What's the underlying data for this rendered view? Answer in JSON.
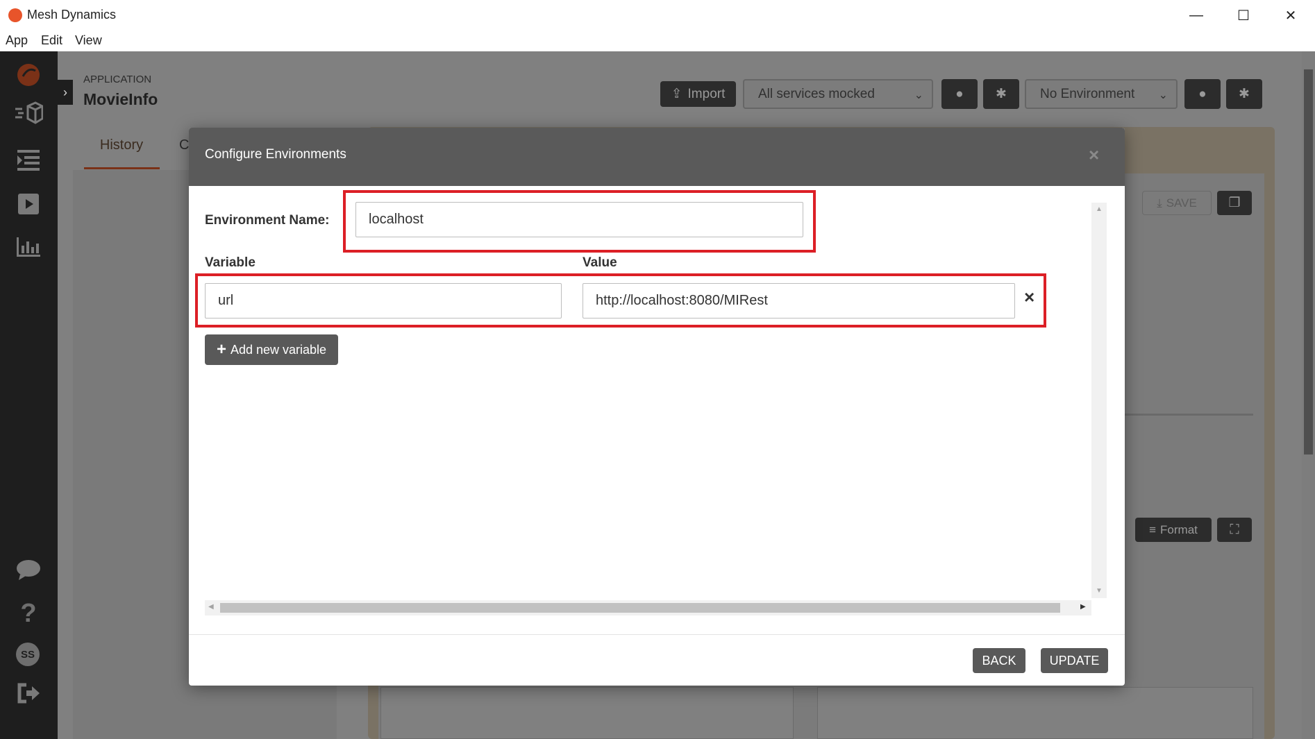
{
  "window": {
    "title": "Mesh Dynamics",
    "minimize_glyph": "—",
    "maximize_glyph": "☐",
    "close_glyph": "✕"
  },
  "menu": [
    "App",
    "Edit",
    "View"
  ],
  "sidebar": {
    "icons": [
      "logo-icon",
      "cube-icon",
      "list-icon",
      "play-icon",
      "bar-chart-icon",
      "chat-icon",
      "help-icon",
      "avatar",
      "logout-icon"
    ],
    "avatar_initials": "SS"
  },
  "panel": {
    "section_label": "APPLICATION",
    "app_name": "MovieInfo",
    "tabs": [
      "History",
      "C"
    ],
    "accent_color": "#e8542a"
  },
  "toolbar": {
    "import_label": "Import",
    "services_select": "All services mocked",
    "environment_select": "No Environment"
  },
  "editor": {
    "save_label": "SAVE",
    "format_label": "Format"
  },
  "modal": {
    "title": "Configure Environments",
    "env_name_label": "Environment Name:",
    "env_name_value": "localhost",
    "variable_header": "Variable",
    "value_header": "Value",
    "variables": [
      {
        "name": "url",
        "value": "http://localhost:8080/MIRest"
      }
    ],
    "add_variable_label": "Add new variable",
    "back_label": "BACK",
    "update_label": "UPDATE",
    "highlight_color": "#dc1f26"
  }
}
